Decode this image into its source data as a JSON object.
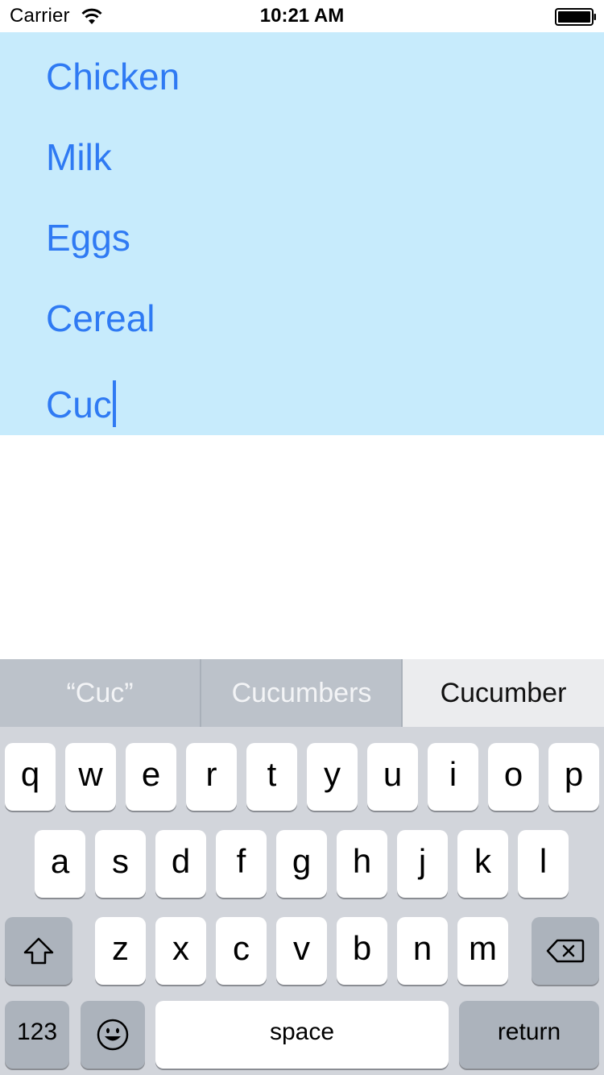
{
  "status_bar": {
    "carrier": "Carrier",
    "time": "10:21 AM",
    "wifi_icon": "wifi-icon",
    "battery_icon": "battery-icon"
  },
  "list": {
    "items": [
      "Chicken",
      "Milk",
      "Eggs",
      "Cereal"
    ],
    "current_text": "Cuc",
    "background_color": "#c7ebfc",
    "text_color": "#2f7af3"
  },
  "keyboard": {
    "suggestions": [
      "“Cuc”",
      "Cucumbers",
      "Cucumber"
    ],
    "row1": [
      "q",
      "w",
      "e",
      "r",
      "t",
      "y",
      "u",
      "i",
      "o",
      "p"
    ],
    "row2": [
      "a",
      "s",
      "d",
      "f",
      "g",
      "h",
      "j",
      "k",
      "l"
    ],
    "row3": [
      "z",
      "x",
      "c",
      "v",
      "b",
      "n",
      "m"
    ],
    "numbers_label": "123",
    "space_label": "space",
    "return_label": "return",
    "shift_icon": "shift-icon",
    "delete_icon": "delete-icon",
    "emoji_icon": "emoji-icon"
  }
}
